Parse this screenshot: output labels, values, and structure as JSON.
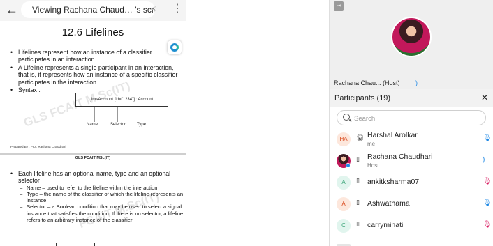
{
  "screen_share": {
    "title": "Viewing Rachana Chaud… 's screen",
    "slide1": {
      "title": "12.6 Lifelines",
      "bullets": [
        "Lifelines represent how an instance of a classifier participates in an interaction",
        "A Lifeline represents a single participant in an interaction, that is, it represents how an instance of a specific classifier participates in the interaction",
        "Syntax :"
      ],
      "syntax_box": "jimsAccount [id=\"1234\"] : Account",
      "labels": [
        "Name",
        "Selector",
        "Type"
      ],
      "prepared_by": "Prepared By : Prof. Rachana Chaudhari",
      "watermark": "GLS FCAIT M.Sc(IT)"
    },
    "slide2": {
      "header": "GLS FCAIT MSc(IT)",
      "bullet": "Each lifeline has an optional name, type and an optional selector",
      "subbullets": [
        "Name – used to refer to the lifeline within the interaction",
        "Type – the name of the classifier of which the lifeline represents an instance",
        "Selector – a Boolean condition that may be used to select a signal instance that satisfies the condition. If there is no selector, a lifeline refers to an arbitrary instance of the classifier"
      ],
      "watermark": "FCAIT M.Sc(IT)"
    }
  },
  "video_tile": {
    "collapse_label": "⇥",
    "name": "Rachana Chau...   (Host)"
  },
  "participants_panel": {
    "title": "Participants (19)",
    "search_placeholder": "Search",
    "participants": [
      {
        "initials": "HA",
        "name": "Harshal Arolkar",
        "sub": "me",
        "device": "headset",
        "mic": "on"
      },
      {
        "initials": "",
        "name": "Rachana Chaudhari",
        "sub": "Host",
        "device": "phone",
        "mic": "on"
      },
      {
        "initials": "A",
        "name": "ankitksharma07",
        "sub": "",
        "device": "phone",
        "mic": "muted"
      },
      {
        "initials": "A",
        "name": "Ashwathama",
        "sub": "",
        "device": "phone",
        "mic": "on"
      },
      {
        "initials": "C",
        "name": "carryminati",
        "sub": "",
        "device": "phone",
        "mic": "muted"
      }
    ]
  },
  "colors": {
    "accent": "#1e88e5",
    "muted": "#d81b60"
  }
}
